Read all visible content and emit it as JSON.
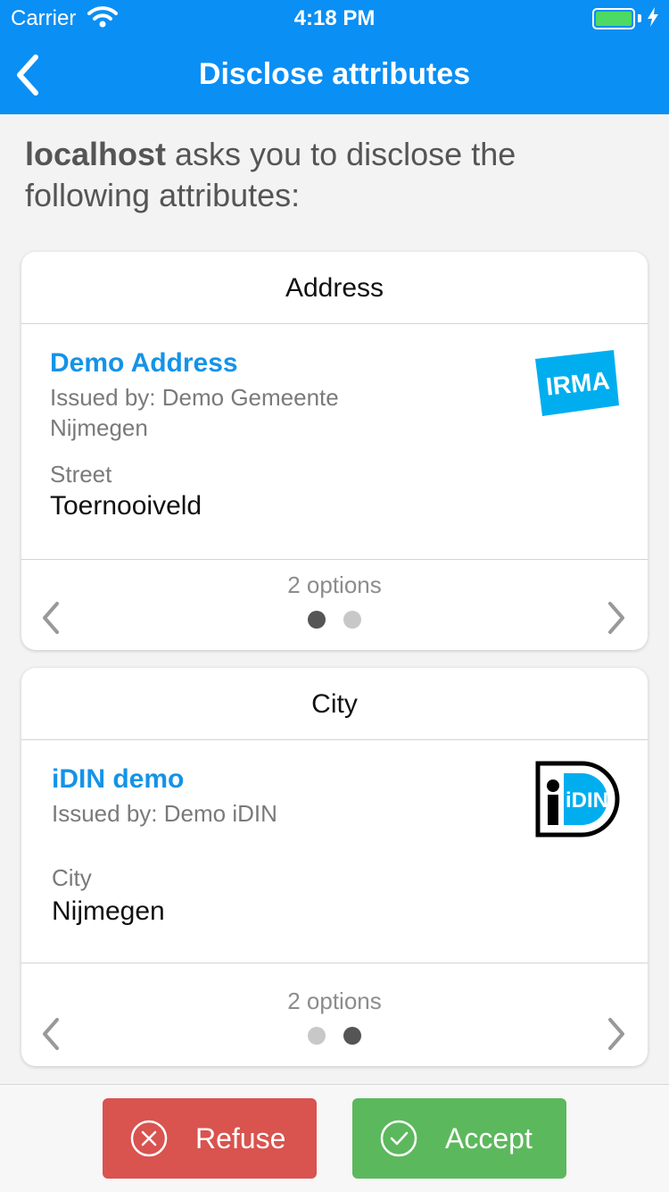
{
  "status_bar": {
    "carrier": "Carrier",
    "time": "4:18 PM",
    "battery_level": 1.0
  },
  "nav": {
    "title": "Disclose attributes"
  },
  "prompt": {
    "host": "localhost",
    "text": " asks you to disclose the following attributes:"
  },
  "cards": [
    {
      "header": "Address",
      "credential_name": "Demo Address",
      "issuer": "Issued by: Demo Gemeente Nijmegen",
      "logo": "irma-logo",
      "logo_text": "IRMA",
      "attribute_label": "Street",
      "attribute_value": "Toernooiveld",
      "options_text": "2 options",
      "active_option": 1
    },
    {
      "header": "City",
      "credential_name": "iDIN demo",
      "issuer": "Issued by: Demo iDIN",
      "logo": "idin-logo",
      "logo_text": "iDIN",
      "attribute_label": "City",
      "attribute_value": "Nijmegen",
      "options_text": "2 options",
      "active_option": 2
    }
  ],
  "actions": {
    "refuse_label": "Refuse",
    "accept_label": "Accept"
  },
  "colors": {
    "nav": "#0a8ff5",
    "link": "#1493e8",
    "refuse": "#d9534f",
    "accept": "#5cb85c"
  }
}
